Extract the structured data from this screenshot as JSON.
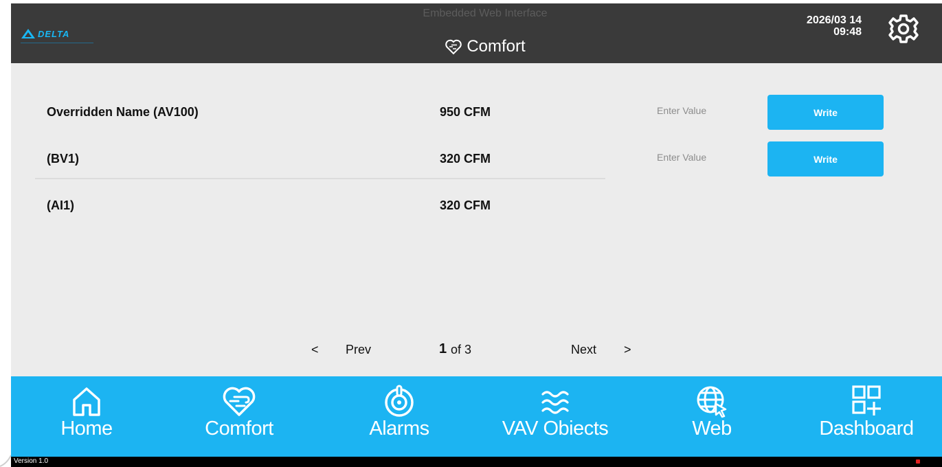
{
  "header": {
    "brand": "DELTA",
    "app_title": "Embedded Web Interface",
    "page_title": "Comfort",
    "date": "2026/03 14",
    "time": "09:48"
  },
  "rows": [
    {
      "name": "Overridden Name (AV100)",
      "value": "950 CFM",
      "placeholder": "Enter Value",
      "button": "Write"
    },
    {
      "name": "(BV1)",
      "value": "320 CFM",
      "placeholder": "Enter Value",
      "button": "Write"
    },
    {
      "name": "(AI1)",
      "value": "320 CFM"
    }
  ],
  "pagination": {
    "prev_label": "Prev",
    "next_label": "Next",
    "current_page": "1",
    "of_label": "of 3",
    "prev_chevron": "<",
    "next_chevron": ">"
  },
  "nav": [
    {
      "label": "Home",
      "icon": "home-icon"
    },
    {
      "label": "Comfort",
      "icon": "heart-comfort-icon"
    },
    {
      "label": "Alarms",
      "icon": "alarm-icon"
    },
    {
      "label": "VAV Obiects",
      "icon": "airflow-waves-icon"
    },
    {
      "label": "Web",
      "icon": "globe-cursor-icon"
    },
    {
      "label": "Dashboard",
      "icon": "dashboard-grid-icon"
    }
  ],
  "footer": {
    "version": "Version 1.0"
  },
  "colors": {
    "accent": "#1cb4f2",
    "header_bg": "#3a3a3a",
    "content_bg": "#ececec",
    "footer_bg": "#000000"
  }
}
